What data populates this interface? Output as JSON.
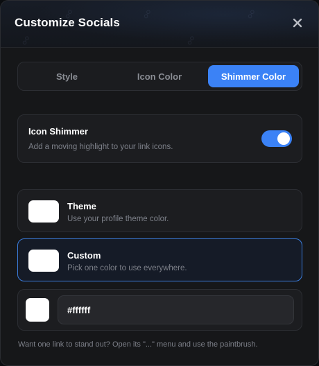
{
  "header": {
    "title": "Customize Socials",
    "close_icon": "close-icon",
    "background_pattern_icon": "link-icon"
  },
  "tabs": [
    {
      "label": "Style",
      "active": false
    },
    {
      "label": "Icon Color",
      "active": false
    },
    {
      "label": "Shimmer Color",
      "active": true
    }
  ],
  "shimmer": {
    "title": "Icon Shimmer",
    "description": "Add a moving highlight to your link icons.",
    "enabled": true
  },
  "options": {
    "theme": {
      "title": "Theme",
      "description": "Use your profile theme color.",
      "selected": false
    },
    "custom": {
      "title": "Custom",
      "description": "Pick one color to use everywhere.",
      "selected": true
    }
  },
  "color_picker": {
    "value": "#ffffff",
    "swatch_color": "#ffffff"
  },
  "footer_note": "Want one link to stand out? Open its \"...\" menu and use the paintbrush.",
  "colors": {
    "accent": "#3b82f6",
    "background": "#161719",
    "card": "#1c1d20"
  }
}
